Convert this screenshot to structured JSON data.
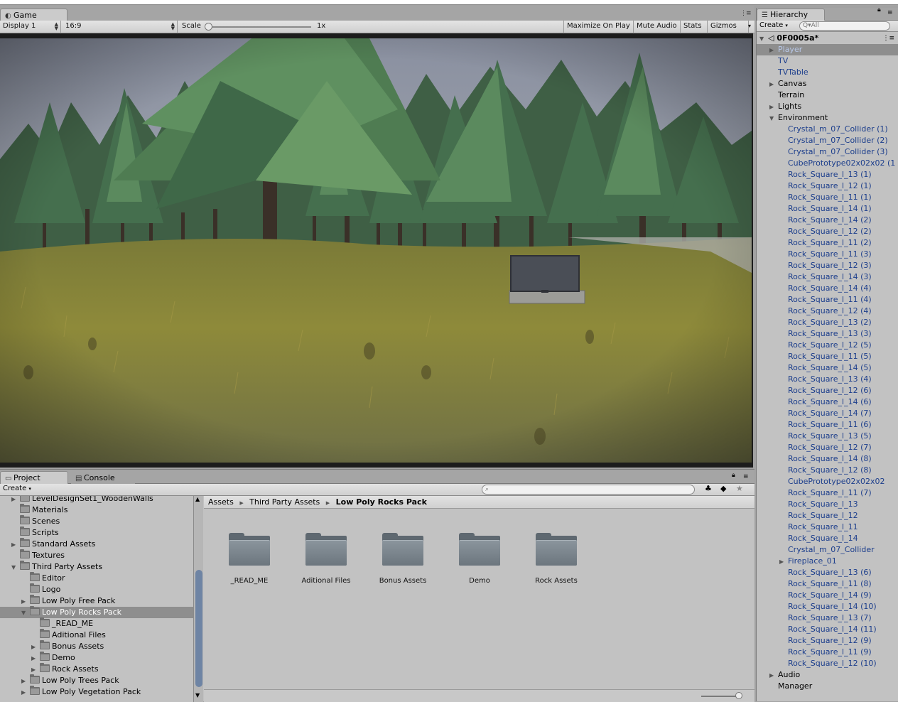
{
  "game": {
    "tab_label": "Game",
    "display": "Display 1",
    "aspect": "16:9",
    "scale_label": "Scale",
    "scale_value": "1x",
    "buttons": [
      "Maximize On Play",
      "Mute Audio",
      "Stats",
      "Gizmos"
    ]
  },
  "hierarchy": {
    "tab_label": "Hierarchy",
    "create_label": "Create",
    "search_placeholder": "All",
    "scene_name": "0F0005a*",
    "items": [
      {
        "label": "Player",
        "indent": 1,
        "arrow": "right",
        "color": "blue",
        "selected": true
      },
      {
        "label": "TV",
        "indent": 1,
        "arrow": "",
        "color": "blue"
      },
      {
        "label": "TVTable",
        "indent": 1,
        "arrow": "",
        "color": "blue"
      },
      {
        "label": "Canvas",
        "indent": 1,
        "arrow": "right",
        "color": "black"
      },
      {
        "label": "Terrain",
        "indent": 1,
        "arrow": "",
        "color": "black"
      },
      {
        "label": "Lights",
        "indent": 1,
        "arrow": "right",
        "color": "black"
      },
      {
        "label": "Environment",
        "indent": 1,
        "arrow": "down",
        "color": "black"
      },
      {
        "label": "Crystal_m_07_Collider (1)",
        "indent": 2,
        "arrow": "",
        "color": "blue"
      },
      {
        "label": "Crystal_m_07_Collider (2)",
        "indent": 2,
        "arrow": "",
        "color": "blue"
      },
      {
        "label": "Crystal_m_07_Collider (3)",
        "indent": 2,
        "arrow": "",
        "color": "blue"
      },
      {
        "label": "CubePrototype02x02x02 (1",
        "indent": 2,
        "arrow": "",
        "color": "blue"
      },
      {
        "label": "Rock_Square_l_13 (1)",
        "indent": 2,
        "arrow": "",
        "color": "blue"
      },
      {
        "label": "Rock_Square_l_12 (1)",
        "indent": 2,
        "arrow": "",
        "color": "blue"
      },
      {
        "label": "Rock_Square_l_11 (1)",
        "indent": 2,
        "arrow": "",
        "color": "blue"
      },
      {
        "label": "Rock_Square_l_14 (1)",
        "indent": 2,
        "arrow": "",
        "color": "blue"
      },
      {
        "label": "Rock_Square_l_14 (2)",
        "indent": 2,
        "arrow": "",
        "color": "blue"
      },
      {
        "label": "Rock_Square_l_12 (2)",
        "indent": 2,
        "arrow": "",
        "color": "blue"
      },
      {
        "label": "Rock_Square_l_11 (2)",
        "indent": 2,
        "arrow": "",
        "color": "blue"
      },
      {
        "label": "Rock_Square_l_11 (3)",
        "indent": 2,
        "arrow": "",
        "color": "blue"
      },
      {
        "label": "Rock_Square_l_12 (3)",
        "indent": 2,
        "arrow": "",
        "color": "blue"
      },
      {
        "label": "Rock_Square_l_14 (3)",
        "indent": 2,
        "arrow": "",
        "color": "blue"
      },
      {
        "label": "Rock_Square_l_14 (4)",
        "indent": 2,
        "arrow": "",
        "color": "blue"
      },
      {
        "label": "Rock_Square_l_11 (4)",
        "indent": 2,
        "arrow": "",
        "color": "blue"
      },
      {
        "label": "Rock_Square_l_12 (4)",
        "indent": 2,
        "arrow": "",
        "color": "blue"
      },
      {
        "label": "Rock_Square_l_13 (2)",
        "indent": 2,
        "arrow": "",
        "color": "blue"
      },
      {
        "label": "Rock_Square_l_13 (3)",
        "indent": 2,
        "arrow": "",
        "color": "blue"
      },
      {
        "label": "Rock_Square_l_12 (5)",
        "indent": 2,
        "arrow": "",
        "color": "blue"
      },
      {
        "label": "Rock_Square_l_11 (5)",
        "indent": 2,
        "arrow": "",
        "color": "blue"
      },
      {
        "label": "Rock_Square_l_14 (5)",
        "indent": 2,
        "arrow": "",
        "color": "blue"
      },
      {
        "label": "Rock_Square_l_13 (4)",
        "indent": 2,
        "arrow": "",
        "color": "blue"
      },
      {
        "label": "Rock_Square_l_12 (6)",
        "indent": 2,
        "arrow": "",
        "color": "blue"
      },
      {
        "label": "Rock_Square_l_14 (6)",
        "indent": 2,
        "arrow": "",
        "color": "blue"
      },
      {
        "label": "Rock_Square_l_14 (7)",
        "indent": 2,
        "arrow": "",
        "color": "blue"
      },
      {
        "label": "Rock_Square_l_11 (6)",
        "indent": 2,
        "arrow": "",
        "color": "blue"
      },
      {
        "label": "Rock_Square_l_13 (5)",
        "indent": 2,
        "arrow": "",
        "color": "blue"
      },
      {
        "label": "Rock_Square_l_12 (7)",
        "indent": 2,
        "arrow": "",
        "color": "blue"
      },
      {
        "label": "Rock_Square_l_14 (8)",
        "indent": 2,
        "arrow": "",
        "color": "blue"
      },
      {
        "label": "Rock_Square_l_12 (8)",
        "indent": 2,
        "arrow": "",
        "color": "blue"
      },
      {
        "label": "CubePrototype02x02x02",
        "indent": 2,
        "arrow": "",
        "color": "blue"
      },
      {
        "label": "Rock_Square_l_11 (7)",
        "indent": 2,
        "arrow": "",
        "color": "blue"
      },
      {
        "label": "Rock_Square_l_13",
        "indent": 2,
        "arrow": "",
        "color": "blue"
      },
      {
        "label": "Rock_Square_l_12",
        "indent": 2,
        "arrow": "",
        "color": "blue"
      },
      {
        "label": "Rock_Square_l_11",
        "indent": 2,
        "arrow": "",
        "color": "blue"
      },
      {
        "label": "Rock_Square_l_14",
        "indent": 2,
        "arrow": "",
        "color": "blue"
      },
      {
        "label": "Crystal_m_07_Collider",
        "indent": 2,
        "arrow": "",
        "color": "blue"
      },
      {
        "label": "Fireplace_01",
        "indent": 2,
        "arrow": "right",
        "color": "blue"
      },
      {
        "label": "Rock_Square_l_13 (6)",
        "indent": 2,
        "arrow": "",
        "color": "blue"
      },
      {
        "label": "Rock_Square_l_11 (8)",
        "indent": 2,
        "arrow": "",
        "color": "blue"
      },
      {
        "label": "Rock_Square_l_14 (9)",
        "indent": 2,
        "arrow": "",
        "color": "blue"
      },
      {
        "label": "Rock_Square_l_14 (10)",
        "indent": 2,
        "arrow": "",
        "color": "blue"
      },
      {
        "label": "Rock_Square_l_13 (7)",
        "indent": 2,
        "arrow": "",
        "color": "blue"
      },
      {
        "label": "Rock_Square_l_14 (11)",
        "indent": 2,
        "arrow": "",
        "color": "blue"
      },
      {
        "label": "Rock_Square_l_12 (9)",
        "indent": 2,
        "arrow": "",
        "color": "blue"
      },
      {
        "label": "Rock_Square_l_11 (9)",
        "indent": 2,
        "arrow": "",
        "color": "blue"
      },
      {
        "label": "Rock_Square_l_12 (10)",
        "indent": 2,
        "arrow": "",
        "color": "blue"
      },
      {
        "label": "Audio",
        "indent": 1,
        "arrow": "right",
        "color": "black"
      },
      {
        "label": "Manager",
        "indent": 1,
        "arrow": "",
        "color": "black"
      }
    ]
  },
  "project": {
    "tab_label": "Project",
    "console_label": "Console",
    "create_label": "Create",
    "tree": [
      {
        "label": "LevelDesignSet1_WoodenWalls",
        "indent": 1,
        "arrow": "right"
      },
      {
        "label": "Materials",
        "indent": 1,
        "arrow": ""
      },
      {
        "label": "Scenes",
        "indent": 1,
        "arrow": ""
      },
      {
        "label": "Scripts",
        "indent": 1,
        "arrow": ""
      },
      {
        "label": "Standard Assets",
        "indent": 1,
        "arrow": "right"
      },
      {
        "label": "Textures",
        "indent": 1,
        "arrow": ""
      },
      {
        "label": "Third Party Assets",
        "indent": 1,
        "arrow": "down"
      },
      {
        "label": "Editor",
        "indent": 2,
        "arrow": ""
      },
      {
        "label": "Logo",
        "indent": 2,
        "arrow": ""
      },
      {
        "label": "Low Poly Free Pack",
        "indent": 2,
        "arrow": "right"
      },
      {
        "label": "Low Poly Rocks Pack",
        "indent": 2,
        "arrow": "down",
        "selected": true
      },
      {
        "label": "_READ_ME",
        "indent": 3,
        "arrow": ""
      },
      {
        "label": "Aditional Files",
        "indent": 3,
        "arrow": ""
      },
      {
        "label": "Bonus Assets",
        "indent": 3,
        "arrow": "right"
      },
      {
        "label": "Demo",
        "indent": 3,
        "arrow": "right"
      },
      {
        "label": "Rock Assets",
        "indent": 3,
        "arrow": "right"
      },
      {
        "label": "Low Poly Trees Pack",
        "indent": 2,
        "arrow": "right"
      },
      {
        "label": "Low Poly Vegetation Pack",
        "indent": 2,
        "arrow": "right"
      }
    ],
    "breadcrumb": [
      "Assets",
      "Third Party Assets",
      "Low Poly Rocks Pack"
    ],
    "folders": [
      "_READ_ME",
      "Aditional Files",
      "Bonus Assets",
      "Demo",
      "Rock Assets"
    ]
  },
  "colors": {
    "panel_bg": "#c2c2c2",
    "selection": "#8e8e8e",
    "prefab_blue": "#1c3e8c"
  }
}
